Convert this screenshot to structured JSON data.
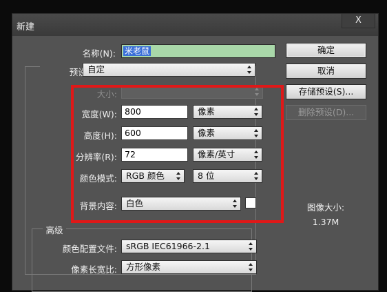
{
  "dialog": {
    "title": "新建",
    "close_label": "X"
  },
  "fields": {
    "name_label": "名称(N):",
    "name_value": "米老鼠",
    "preset_label": "预设:",
    "preset_value": "自定",
    "size_label": "大小:",
    "size_value": "",
    "width_label": "宽度(W):",
    "width_value": "800",
    "width_unit": "像素",
    "height_label": "高度(H):",
    "height_value": "600",
    "height_unit": "像素",
    "resolution_label": "分辨率(R):",
    "resolution_value": "72",
    "resolution_unit": "像素/英寸",
    "color_mode_label": "颜色模式:",
    "color_mode_value": "RGB 颜色",
    "bit_depth_value": "8 位",
    "background_label": "背景内容:",
    "background_value": "白色"
  },
  "advanced": {
    "section_label": "高级",
    "color_profile_label": "颜色配置文件:",
    "color_profile_value": "sRGB IEC61966-2.1",
    "pixel_aspect_label": "像素长宽比:",
    "pixel_aspect_value": "方形像素"
  },
  "buttons": {
    "ok": "确定",
    "cancel": "取消",
    "save_preset": "存储预设(S)...",
    "delete_preset": "删除预设(D)..."
  },
  "image_size": {
    "label": "图像大小:",
    "value": "1.37M"
  },
  "colors": {
    "dialog_bg": "#535353",
    "highlight_box": "#e01818",
    "name_field_bg": "#a9d8a9",
    "selection": "#3a6fd8"
  }
}
